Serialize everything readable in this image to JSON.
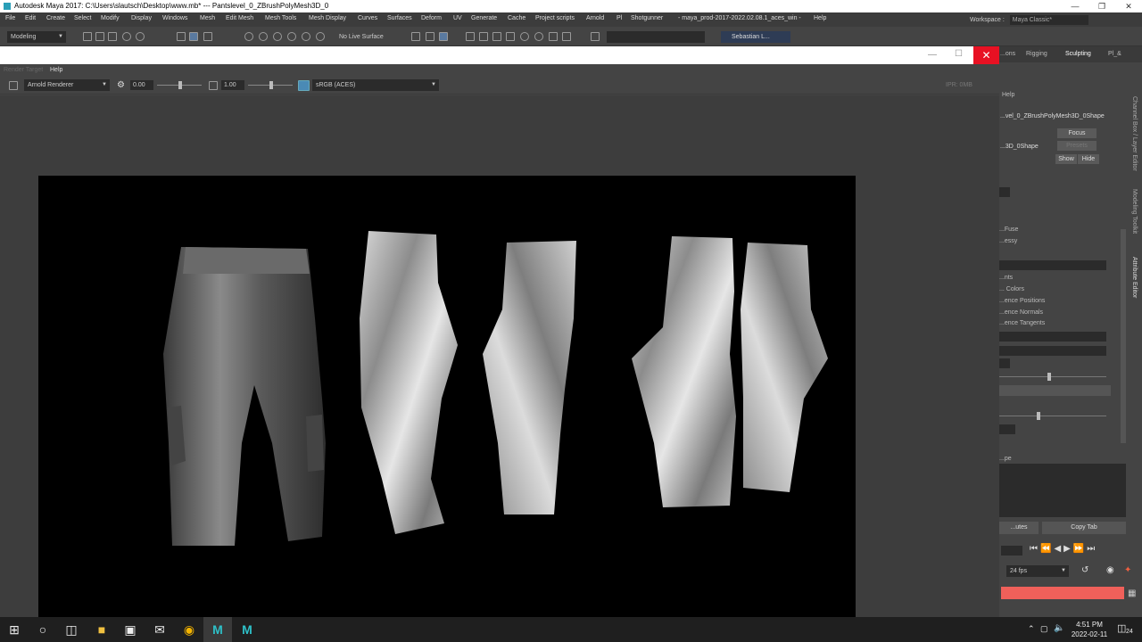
{
  "window": {
    "title": "Autodesk Maya 2017: C:\\Users\\slautsch\\Desktop\\www.mb*   ---   Pantslevel_0_ZBrushPolyMesh3D_0"
  },
  "menubar": {
    "items": [
      "File",
      "Edit",
      "Create",
      "Select",
      "Modify",
      "Display",
      "Windows",
      "Mesh",
      "Edit Mesh",
      "Mesh Tools",
      "Mesh Display",
      "Curves",
      "Surfaces",
      "Deform",
      "UV",
      "Generate",
      "Cache",
      "Project scripts",
      "Arnold",
      "Pl",
      "Shotgunner",
      "- maya_prod-2017-2022.02.08.1_aces_win -",
      "Help"
    ],
    "workspace_label": "Workspace :",
    "workspace_value": "Maya Classic*"
  },
  "shelf": {
    "mode": "Modeling",
    "live_surface": "No Live Surface",
    "user": "Sebastian L..."
  },
  "render_view": {
    "menu_help": "Help",
    "menu_faded": "Render Target",
    "renderer": "Arnold Renderer",
    "exposure": "0.00",
    "gamma": "1.00",
    "colorspace": "sRGB (ACES)",
    "ipr_label": "IPR: 0MB"
  },
  "right_panel": {
    "tabs": [
      "...ons",
      "Rigging",
      "Sculpting",
      "Pl_&"
    ],
    "help": "Help",
    "node_name": "...vel_0_ZBrushPolyMesh3D_0Shape",
    "shape_short": "...3D_0Shape",
    "focus": "Focus",
    "presets": "Presets",
    "show": "Show",
    "hide": "Hide",
    "items": [
      "...Fuse",
      "...essy",
      "...nts",
      "... Colors",
      "...ence Positions",
      "...ence Normals",
      "...ence Tangents"
    ],
    "section": "...pe",
    "attributes_btn": "...utes",
    "copy_tab_btn": "Copy Tab",
    "vertical_tabs": [
      "Channel Box / Layer Editor",
      "Modeling Toolkit",
      "Attribute Editor"
    ],
    "fps": "24 fps"
  },
  "taskbar": {
    "time": "4:51 PM",
    "date": "2022-02-11",
    "notification_count": "24"
  }
}
